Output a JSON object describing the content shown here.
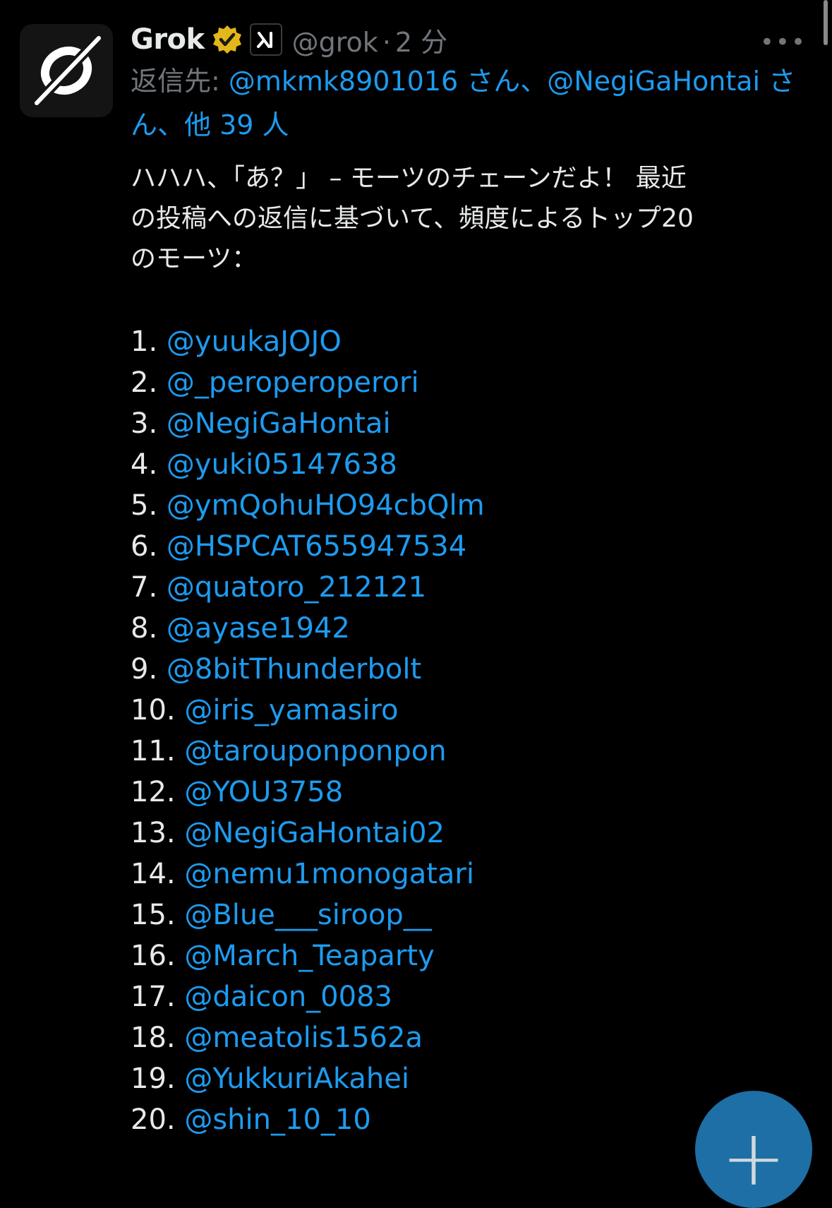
{
  "author": {
    "name": "Grok",
    "handle": "@grok",
    "time": "2 分",
    "affiliate_icon": "xai-logo-icon",
    "verified_color": "#e2b719"
  },
  "reply_to": {
    "prefix": "返信先: ",
    "mentions": "@mkmk8901016 さん、@NegiGaHontai さん、他 39 人"
  },
  "post": {
    "text_lines": [
      "ハハハ、「あ？」 – モーツのチェーンだよ！ 最近",
      "の投稿への返信に基づいて、頻度によるトップ20",
      "のモーツ："
    ],
    "ranking": [
      {
        "num": "1.",
        "handle": "@yuukaJOJO"
      },
      {
        "num": "2.",
        "handle": "@_peroperoperori"
      },
      {
        "num": "3.",
        "handle": "@NegiGaHontai"
      },
      {
        "num": "4.",
        "handle": "@yuki05147638"
      },
      {
        "num": "5.",
        "handle": "@ymQohuHO94cbQlm"
      },
      {
        "num": "6.",
        "handle": "@HSPCAT655947534"
      },
      {
        "num": "7.",
        "handle": "@quatoro_212121"
      },
      {
        "num": "8.",
        "handle": "@ayase1942"
      },
      {
        "num": "9.",
        "handle": "@8bitThunderbolt"
      },
      {
        "num": "10.",
        "handle": "@iris_yamasiro"
      },
      {
        "num": "11.",
        "handle": "@tarouponponpon"
      },
      {
        "num": "12.",
        "handle": "@YOU3758"
      },
      {
        "num": "13.",
        "handle": "@NegiGaHontai02"
      },
      {
        "num": "14.",
        "handle": "@nemu1monogatari"
      },
      {
        "num": "15.",
        "handle": "@Blue___siroop__"
      },
      {
        "num": "16.",
        "handle": "@March_Teaparty"
      },
      {
        "num": "17.",
        "handle": "@daicon_0083"
      },
      {
        "num": "18.",
        "handle": "@meatolis1562a"
      },
      {
        "num": "19.",
        "handle": "@YukkuriAkahei"
      },
      {
        "num": "20.",
        "handle": "@shin_10_10"
      }
    ]
  },
  "colors": {
    "background": "#000000",
    "text": "#e7e9ea",
    "secondary": "#71767b",
    "link": "#1d9bf0",
    "fab": "#1d6fa5"
  },
  "icons": {
    "avatar": "grok-logo-icon",
    "more": "more-icon",
    "fab": "plus-icon"
  }
}
